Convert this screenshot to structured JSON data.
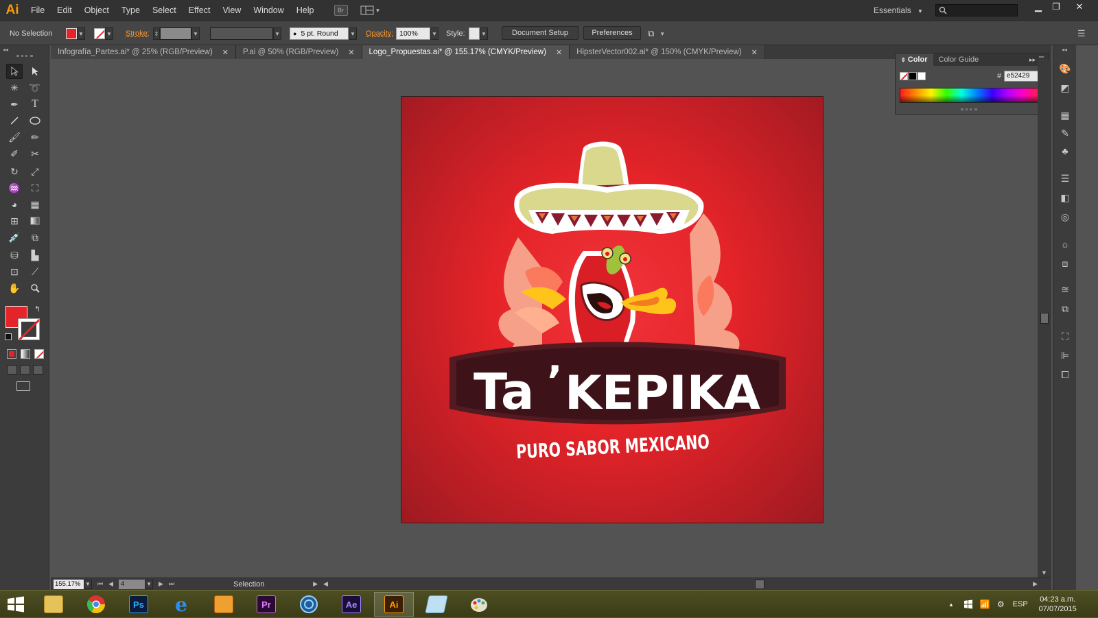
{
  "app": {
    "logo": "Ai",
    "brand_color": "#ff9a00"
  },
  "menu": {
    "items": [
      "File",
      "Edit",
      "Object",
      "Type",
      "Select",
      "Effect",
      "View",
      "Window",
      "Help"
    ],
    "bridge": "Br",
    "workspace": "Essentials"
  },
  "control_bar": {
    "selection_label": "No Selection",
    "fill_color": "#e52429",
    "stroke_label": "Stroke:",
    "brush_value": "5 pt. Round",
    "opacity_label": "Opacity:",
    "opacity_value": "100%",
    "style_label": "Style:",
    "document_setup": "Document Setup",
    "preferences": "Preferences"
  },
  "tabs": [
    {
      "label": "Infografía_Partes.ai* @ 25% (RGB/Preview)",
      "active": false
    },
    {
      "label": "P.ai @ 50% (RGB/Preview)",
      "active": false
    },
    {
      "label": "Logo_Propuestas.ai* @ 155.17% (CMYK/Preview)",
      "active": true
    },
    {
      "label": "HipsterVector002.ai* @ 150% (CMYK/Preview)",
      "active": false
    }
  ],
  "color_panel": {
    "tabs": [
      "Color",
      "Color Guide"
    ],
    "hash": "#",
    "hex_value": "e52429"
  },
  "artwork": {
    "title_left": "Ta",
    "title_apostrophe": "’",
    "title_right": "KEPIKA",
    "tagline": "PURO SABOR MEXICANO",
    "colors": {
      "background": "#e52429",
      "banner": "#3d1218",
      "hat": "#d9d88d",
      "hat_band": "#8a1a2e",
      "chili": "#d91e25",
      "flame_light": "#f6a08a",
      "flame_yellow": "#ffc41a"
    }
  },
  "status_bar": {
    "zoom": "155.17%",
    "artboard_num": "4",
    "tool": "Selection"
  },
  "taskbar": {
    "apps": [
      "explorer",
      "chrome",
      "Ps",
      "ie",
      "outlook",
      "Pr",
      "browser",
      "Ae",
      "Ai",
      "notes",
      "paint"
    ],
    "language": "ESP",
    "time": "04:23 a.m.",
    "date": "07/07/2015"
  }
}
